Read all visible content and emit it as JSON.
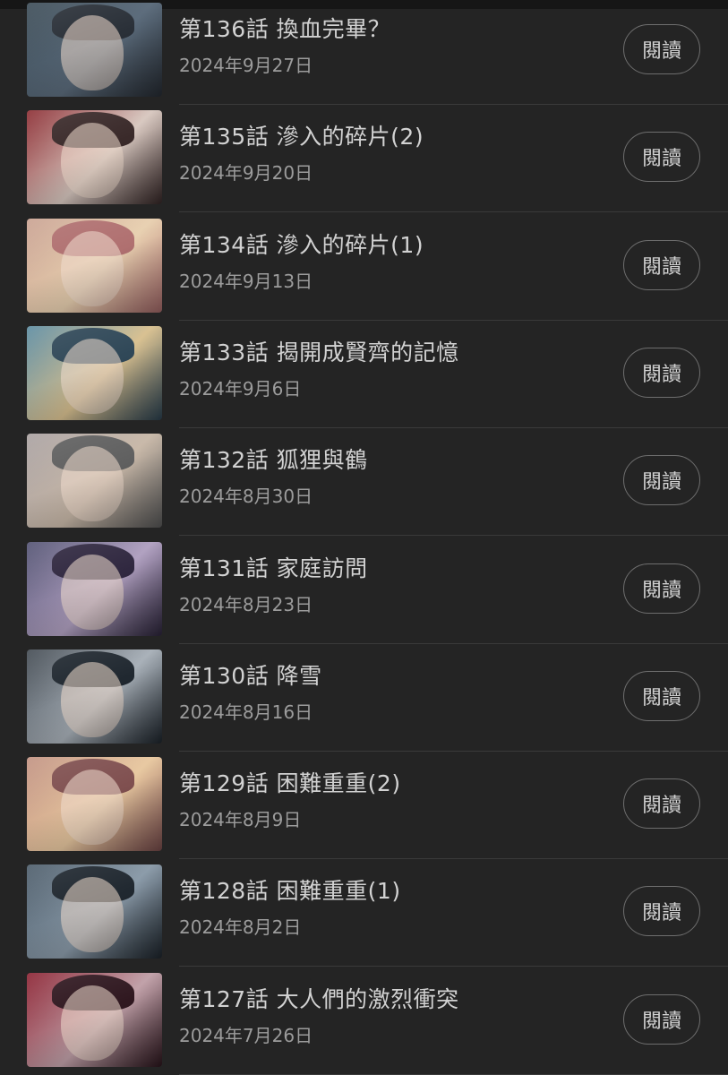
{
  "episodes": [
    {
      "title": "第136話 換血完畢？",
      "date": "2024年9月27日",
      "button": "閱讀",
      "thumb_colors": [
        "#3a4a55",
        "#5a6a7a",
        "#2a3038"
      ]
    },
    {
      "title": "第135話 滲入的碎片(2)",
      "date": "2024年9月20日",
      "button": "閱讀",
      "thumb_colors": [
        "#8a2a30",
        "#d8c8c0",
        "#3a2a2a"
      ]
    },
    {
      "title": "第134話 滲入的碎片(1)",
      "date": "2024年9月13日",
      "button": "閱讀",
      "thumb_colors": [
        "#c8a090",
        "#e8d0b0",
        "#b07070"
      ]
    },
    {
      "title": "第133話 揭開成賢齊的記憶",
      "date": "2024年9月6日",
      "button": "閱讀",
      "thumb_colors": [
        "#5a8aa0",
        "#d8c090",
        "#304858"
      ]
    },
    {
      "title": "第132話 狐狸與鶴",
      "date": "2024年8月30日",
      "button": "閱讀",
      "thumb_colors": [
        "#a8a0a0",
        "#c8b8a8",
        "#606060"
      ]
    },
    {
      "title": "第131話 家庭訪問",
      "date": "2024年8月23日",
      "button": "閱讀",
      "thumb_colors": [
        "#505070",
        "#b0a0c0",
        "#302840"
      ]
    },
    {
      "title": "第130話 降雪",
      "date": "2024年8月16日",
      "button": "閱讀",
      "thumb_colors": [
        "#404850",
        "#a8b0b8",
        "#202830"
      ]
    },
    {
      "title": "第129話 困難重重(2)",
      "date": "2024年8月9日",
      "button": "閱讀",
      "thumb_colors": [
        "#c09080",
        "#e8c8a0",
        "#805050"
      ]
    },
    {
      "title": "第128話 困難重重(1)",
      "date": "2024年8月2日",
      "button": "閱讀",
      "thumb_colors": [
        "#4a5a68",
        "#8a9aa8",
        "#202830"
      ]
    },
    {
      "title": "第127話 大人們的激烈衝突",
      "date": "2024年7月26日",
      "button": "閱讀",
      "thumb_colors": [
        "#8a2030",
        "#c0a0a8",
        "#301820"
      ]
    }
  ],
  "colors": {
    "background": "#242424",
    "title": "#d2d2d2",
    "date": "#9c9c9c",
    "button_border": "#6e6e6e"
  }
}
